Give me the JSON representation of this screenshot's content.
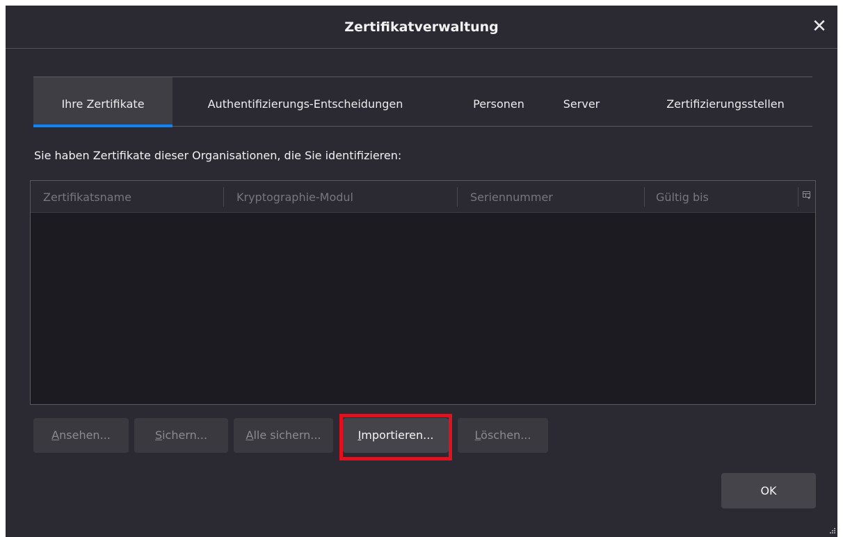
{
  "window": {
    "title": "Zertifikatverwaltung",
    "close_glyph": "✕"
  },
  "tabs": [
    {
      "label": "Ihre Zertifikate",
      "active": true
    },
    {
      "label": "Authentifizierungs-Entscheidungen",
      "active": false
    },
    {
      "label": "Personen",
      "active": false
    },
    {
      "label": "Server",
      "active": false
    },
    {
      "label": "Zertifizierungsstellen",
      "active": false
    }
  ],
  "description": "Sie haben Zertifikate dieser Organisationen, die Sie identifizieren:",
  "table": {
    "columns": [
      "Zertifikatsname",
      "Kryptographie-Modul",
      "Seriennummer",
      "Gültig bis"
    ],
    "rows": [],
    "column_picker_icon": "column-picker-icon"
  },
  "buttons": {
    "view": {
      "accesskey": "A",
      "rest": "nsehen...",
      "enabled": false
    },
    "backup": {
      "accesskey": "S",
      "rest": "ichern...",
      "enabled": false
    },
    "backup_all": {
      "accesskey": "A",
      "rest": "lle sichern...",
      "enabled": false
    },
    "import": {
      "accesskey": "I",
      "rest": "mportieren...",
      "enabled": true
    },
    "delete": {
      "accesskey": "L",
      "rest": "öschen...",
      "enabled": false
    }
  },
  "ok_label": "OK",
  "colors": {
    "background": "#2b2a33",
    "table_body": "#1c1b22",
    "accent": "#0a84ff",
    "highlight": "#e3101e"
  }
}
